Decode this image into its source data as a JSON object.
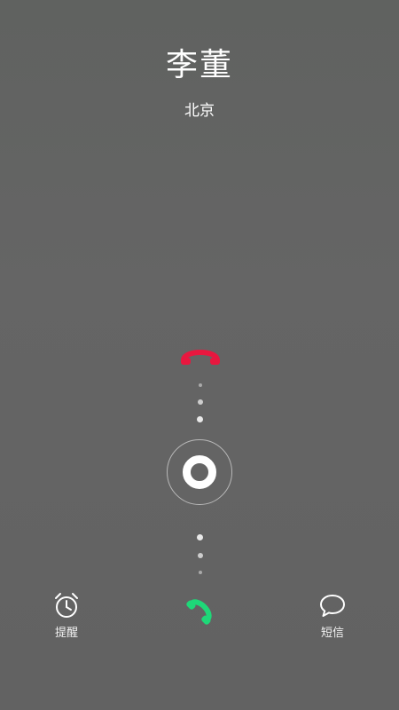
{
  "call": {
    "caller_name": "李董",
    "caller_location": "北京"
  },
  "actions": {
    "remind_label": "提醒",
    "message_label": "短信"
  },
  "icons": {
    "decline": "decline-call-icon",
    "answer": "answer-call-icon",
    "remind": "alarm-clock-icon",
    "message": "speech-bubble-icon"
  },
  "colors": {
    "decline": "#e8173f",
    "answer": "#1ed878",
    "background": "#636363"
  }
}
